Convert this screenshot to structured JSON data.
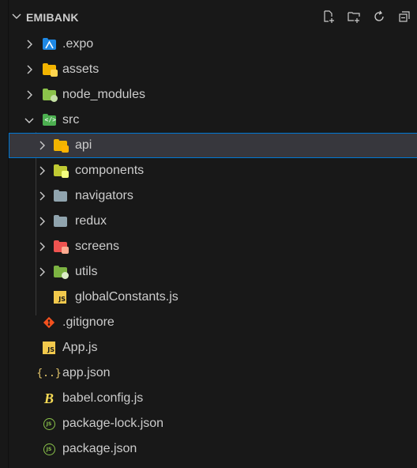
{
  "explorer": {
    "title": "EMIBANK",
    "actions": [
      "new-file-icon",
      "new-folder-icon",
      "refresh-icon",
      "collapse-all-icon"
    ]
  },
  "tree": [
    {
      "label": ".expo",
      "kind": "folder",
      "expanded": false,
      "icon": "expo-folder-icon"
    },
    {
      "label": "assets",
      "kind": "folder",
      "expanded": false,
      "icon": "assets-folder-icon"
    },
    {
      "label": "node_modules",
      "kind": "folder",
      "expanded": false,
      "icon": "node-modules-folder-icon"
    },
    {
      "label": "src",
      "kind": "folder",
      "expanded": true,
      "icon": "src-folder-icon"
    },
    {
      "label": "api",
      "kind": "folder",
      "expanded": false,
      "selected": true,
      "icon": "api-folder-icon"
    },
    {
      "label": "components",
      "kind": "folder",
      "expanded": false,
      "icon": "components-folder-icon"
    },
    {
      "label": "navigators",
      "kind": "folder",
      "expanded": false,
      "icon": "folder-icon"
    },
    {
      "label": "redux",
      "kind": "folder",
      "expanded": false,
      "icon": "folder-icon"
    },
    {
      "label": "screens",
      "kind": "folder",
      "expanded": false,
      "icon": "screens-folder-icon"
    },
    {
      "label": "utils",
      "kind": "folder",
      "expanded": false,
      "icon": "utils-folder-icon"
    },
    {
      "label": "globalConstants.js",
      "kind": "file",
      "icon": "js-file-icon"
    },
    {
      "label": ".gitignore",
      "kind": "file",
      "icon": "git-icon"
    },
    {
      "label": "App.js",
      "kind": "file",
      "icon": "js-file-icon"
    },
    {
      "label": "app.json",
      "kind": "file",
      "icon": "json-icon"
    },
    {
      "label": "babel.config.js",
      "kind": "file",
      "icon": "babel-icon"
    },
    {
      "label": "package-lock.json",
      "kind": "file",
      "icon": "npm-icon"
    },
    {
      "label": "package.json",
      "kind": "file",
      "icon": "npm-icon"
    }
  ],
  "colors": {
    "background": "#181818",
    "selected_row": "#37373d",
    "focus_border": "#0078d4",
    "text": "#cccccc"
  }
}
